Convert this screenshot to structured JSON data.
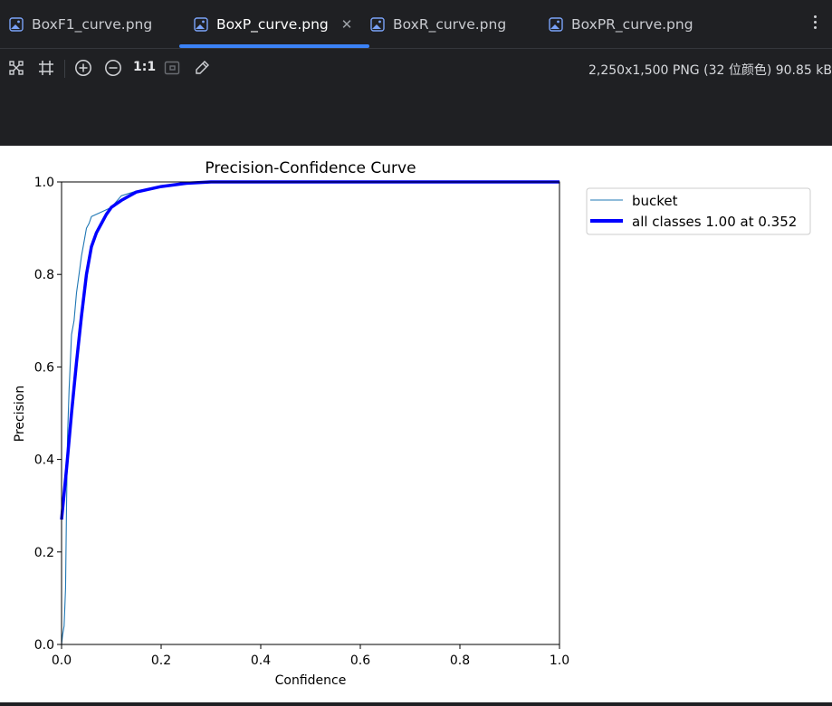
{
  "tabs": [
    {
      "label": "BoxF1_curve.png",
      "active": false
    },
    {
      "label": "BoxP_curve.png",
      "active": true
    },
    {
      "label": "BoxR_curve.png",
      "active": false
    },
    {
      "label": "BoxPR_curve.png",
      "active": false
    }
  ],
  "toolbar": {
    "actual_size_label": "1:1",
    "image_info": "2,250x1,500 PNG (32 位颜色) 90.85 kB"
  },
  "colors": {
    "accent": "#3b82f6",
    "bucket_line": "#1f77b4",
    "all_classes_line": "#0000ff"
  },
  "chart_data": {
    "type": "line",
    "title": "Precision-Confidence Curve",
    "xlabel": "Confidence",
    "ylabel": "Precision",
    "xlim": [
      0,
      1
    ],
    "ylim": [
      0,
      1
    ],
    "xticks": [
      "0.0",
      "0.2",
      "0.4",
      "0.6",
      "0.8",
      "1.0"
    ],
    "yticks": [
      "0.0",
      "0.2",
      "0.4",
      "0.6",
      "0.8",
      "1.0"
    ],
    "grid": false,
    "legend_position": "outside-right",
    "series": [
      {
        "name": "bucket",
        "x": [
          0.0,
          0.002,
          0.005,
          0.008,
          0.01,
          0.012,
          0.015,
          0.018,
          0.02,
          0.025,
          0.03,
          0.035,
          0.04,
          0.045,
          0.05,
          0.055,
          0.06,
          0.08,
          0.1,
          0.12,
          0.15,
          0.2,
          0.3,
          0.5,
          1.0
        ],
        "y": [
          0.0,
          0.02,
          0.04,
          0.12,
          0.3,
          0.45,
          0.55,
          0.62,
          0.67,
          0.7,
          0.76,
          0.8,
          0.84,
          0.87,
          0.9,
          0.91,
          0.925,
          0.935,
          0.945,
          0.97,
          0.98,
          0.99,
          1.0,
          1.0,
          1.0
        ]
      },
      {
        "name": "all classes 1.00 at 0.352",
        "x": [
          0.0,
          0.01,
          0.02,
          0.03,
          0.04,
          0.05,
          0.06,
          0.07,
          0.08,
          0.09,
          0.1,
          0.12,
          0.15,
          0.2,
          0.25,
          0.3,
          0.35,
          0.5,
          1.0
        ],
        "y": [
          0.27,
          0.38,
          0.5,
          0.61,
          0.71,
          0.8,
          0.86,
          0.89,
          0.91,
          0.93,
          0.945,
          0.96,
          0.978,
          0.99,
          0.997,
          1.0,
          1.0,
          1.0,
          1.0
        ]
      }
    ]
  }
}
